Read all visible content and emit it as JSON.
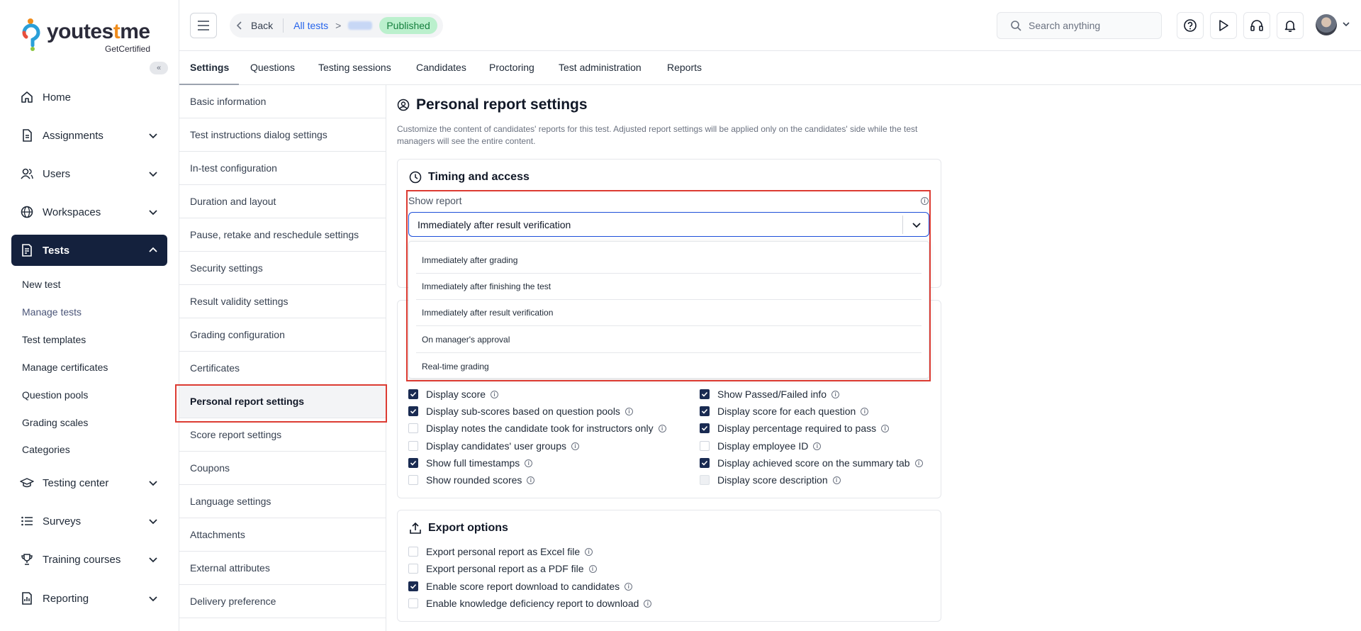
{
  "brand": {
    "name_part1": "youtes",
    "name_part2": "t",
    "name_part3": "me",
    "tagline": "GetCertified",
    "collapse_glyph": "«"
  },
  "sidebar": {
    "items": [
      {
        "label": "Home",
        "icon": "home-icon"
      },
      {
        "label": "Assignments",
        "icon": "document-icon"
      },
      {
        "label": "Users",
        "icon": "users-icon"
      },
      {
        "label": "Workspaces",
        "icon": "globe-icon"
      },
      {
        "label": "Tests",
        "icon": "test-icon"
      },
      {
        "label": "Testing center",
        "icon": "graduation-icon"
      },
      {
        "label": "Surveys",
        "icon": "list-icon"
      },
      {
        "label": "Training courses",
        "icon": "trophy-icon"
      },
      {
        "label": "Reporting",
        "icon": "report-icon"
      }
    ],
    "tests_subitems": [
      "New test",
      "Manage tests",
      "Test templates",
      "Manage certificates",
      "Question pools",
      "Grading scales",
      "Categories"
    ]
  },
  "topbar": {
    "back_label": "Back",
    "crumb_link": "All tests",
    "crumb_sep": ">",
    "status_badge": "Published",
    "search_placeholder": "Search anything"
  },
  "tabs": [
    "Settings",
    "Questions",
    "Testing sessions",
    "Candidates",
    "Proctoring",
    "Test administration",
    "Reports"
  ],
  "settings_menu": [
    "Basic information",
    "Test instructions dialog settings",
    "In-test configuration",
    "Duration and layout",
    "Pause, retake and reschedule settings",
    "Security settings",
    "Result validity settings",
    "Grading configuration",
    "Certificates",
    "Personal report settings",
    "Score report settings",
    "Coupons",
    "Language settings",
    "Attachments",
    "External attributes",
    "Delivery preference"
  ],
  "page": {
    "title": "Personal report settings",
    "description": "Customize the content of candidates' reports for this test. Adjusted report settings will be applied only on the candidates' side while the test managers will see the entire content."
  },
  "timing": {
    "title": "Timing and access",
    "show_report_label": "Show report",
    "selected_value": "Immediately after result verification",
    "options": [
      "Immediately after grading",
      "Immediately after finishing the test",
      "Immediately after result verification",
      "On manager's approval",
      "Real-time grading"
    ]
  },
  "display_options": {
    "left": [
      {
        "label": "Display score",
        "checked": true
      },
      {
        "label": "Display sub-scores based on question pools",
        "checked": true
      },
      {
        "label": "Display notes the candidate took for instructors only",
        "checked": false
      },
      {
        "label": "Display candidates' user groups",
        "checked": false
      },
      {
        "label": "Show full timestamps",
        "checked": true
      },
      {
        "label": "Show rounded scores",
        "checked": false
      }
    ],
    "right": [
      {
        "label": "Show Passed/Failed info",
        "checked": true
      },
      {
        "label": "Display score for each question",
        "checked": true
      },
      {
        "label": "Display percentage required to pass",
        "checked": true
      },
      {
        "label": "Display employee ID",
        "checked": false
      },
      {
        "label": "Display achieved score on the summary tab",
        "checked": true
      },
      {
        "label": "Display score description",
        "checked": false,
        "disabled": true
      }
    ]
  },
  "export": {
    "title": "Export options",
    "items": [
      {
        "label": "Export personal report as Excel file",
        "checked": false
      },
      {
        "label": "Export personal report as a PDF file",
        "checked": false
      },
      {
        "label": "Enable score report download to candidates",
        "checked": true
      },
      {
        "label": "Enable knowledge deficiency report to download",
        "checked": false
      }
    ]
  },
  "colors": {
    "accent_nav": "#14213d",
    "link": "#2563eb",
    "badge_bg": "#bbf0cd",
    "highlight": "#dc3b32",
    "checkbox_on": "#1a2b52"
  }
}
